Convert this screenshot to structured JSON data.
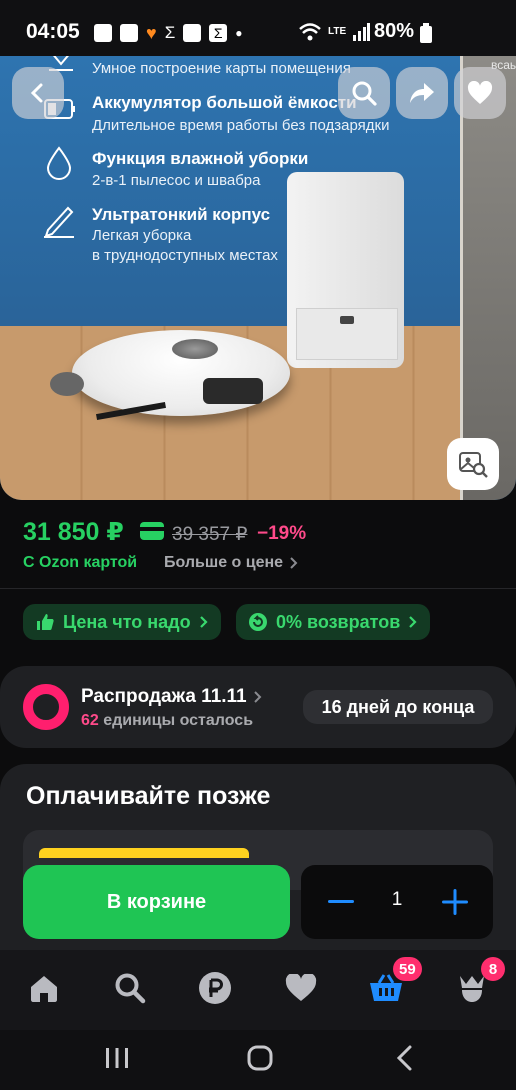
{
  "status_bar": {
    "time": "04:05",
    "battery": "80%",
    "network": "LTE"
  },
  "hero": {
    "partial_top_text": "Умное построение карты помещения",
    "side_partial_text": "всаь",
    "features": [
      {
        "title": "Аккумулятор большой ёмкости",
        "subtitle": "Длительное время работы без подзарядки",
        "icon": "battery-icon"
      },
      {
        "title": "Функция влажной уборки",
        "subtitle": "2-в-1 пылесос и швабра",
        "icon": "water-drop-icon"
      },
      {
        "title": "Ультратонкий корпус",
        "subtitle_line1": "Легкая уборка",
        "subtitle_line2": "в труднодоступных местах",
        "icon": "pen-icon"
      }
    ]
  },
  "price": {
    "current": "31 850 ₽",
    "old": "39 357 ₽",
    "discount": "−19%",
    "ozon_card": "С Ozon картой",
    "more": "Больше о цене"
  },
  "chips": {
    "good_price": "Цена что надо",
    "returns": "0% возвратов"
  },
  "sale": {
    "title": "Распродажа 11.11",
    "count": "62",
    "count_suffix": "единицы осталось",
    "days_left": "16 дней до конца"
  },
  "pay_later": {
    "title": "Оплачивайте позже"
  },
  "cart": {
    "button_label": "В корзине",
    "quantity": "1"
  },
  "tabbar": {
    "cart_badge": "59",
    "profile_badge": "8"
  },
  "colors": {
    "accent_green": "#1fc554",
    "price_green": "#27d162",
    "discount_pink": "#ff4a8a",
    "badge_pink": "#ff2e6e",
    "tab_active_blue": "#1f8cff"
  }
}
